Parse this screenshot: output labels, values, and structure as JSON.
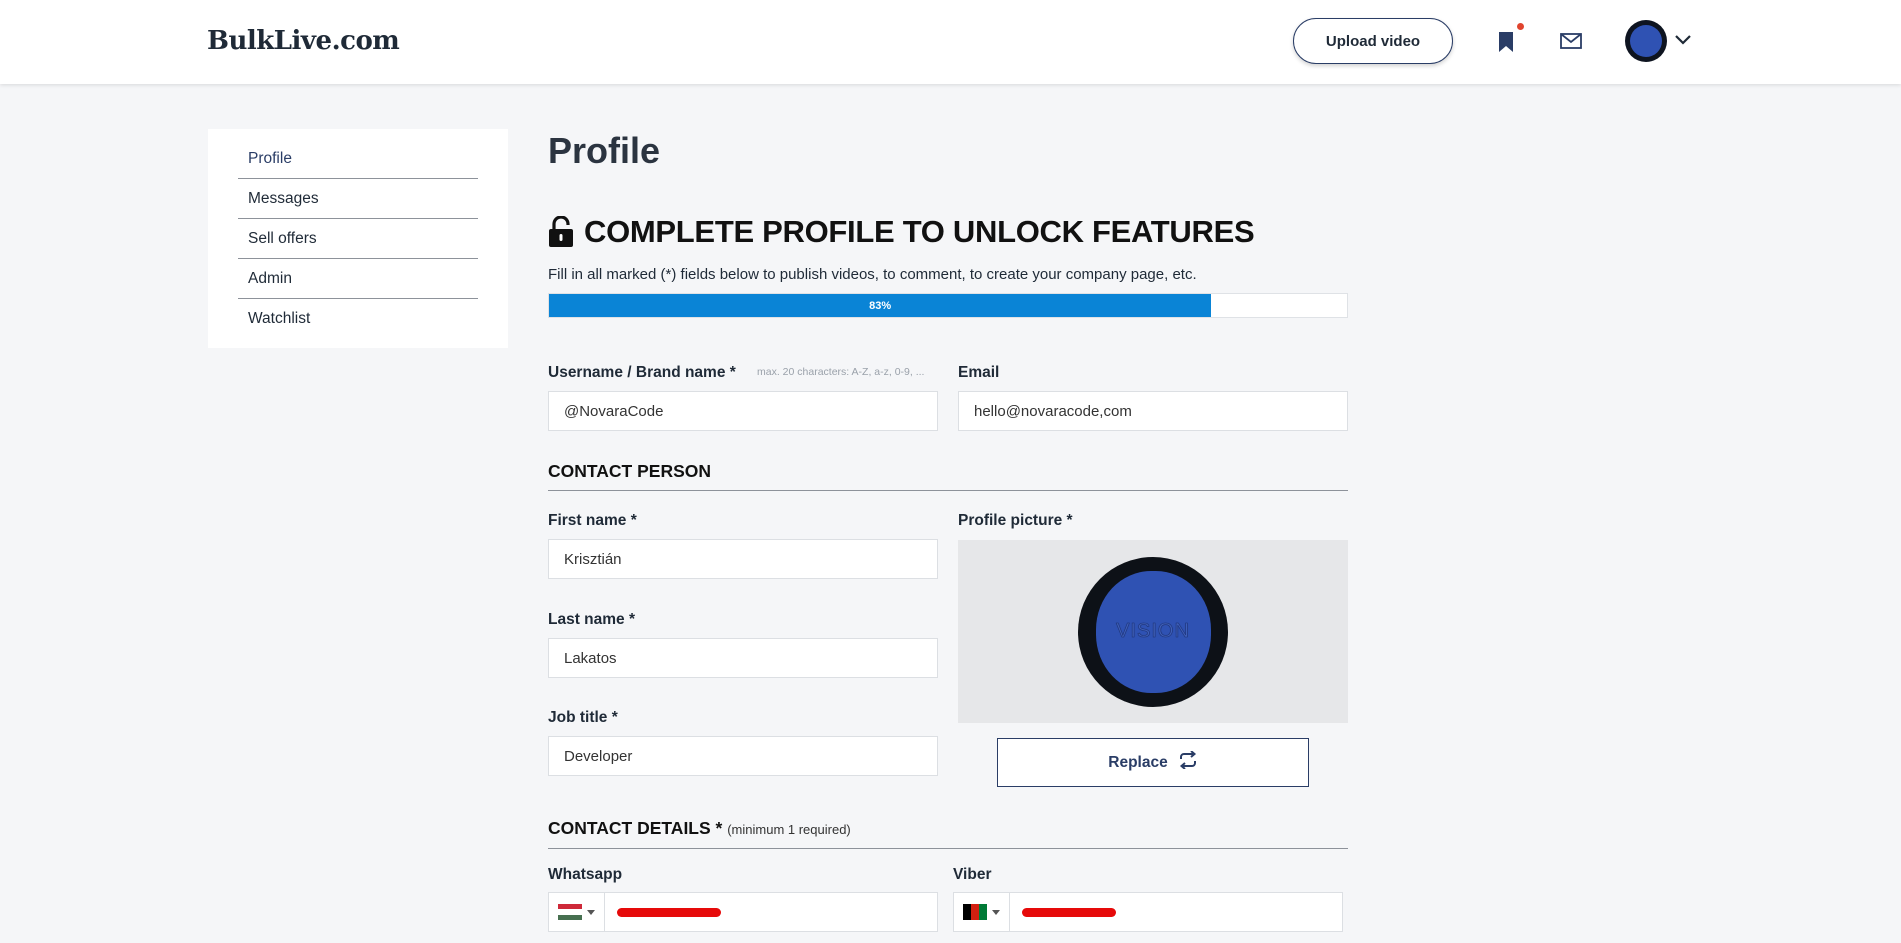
{
  "header": {
    "logo": "BulkLive.com",
    "upload_label": "Upload video",
    "icons": [
      "bookmark-icon",
      "mail-icon",
      "chevron-down-icon"
    ],
    "notification_color": "#e0442e"
  },
  "sidebar": {
    "items": [
      {
        "label": "Profile",
        "active": true
      },
      {
        "label": "Messages"
      },
      {
        "label": "Sell offers"
      },
      {
        "label": "Admin"
      },
      {
        "label": "Watchlist"
      }
    ]
  },
  "main": {
    "title": "Profile",
    "unlock": {
      "heading": "COMPLETE PROFILE TO UNLOCK FEATURES",
      "subtitle": "Fill in all marked (*) fields below to publish videos, to comment, to create your company page, etc.",
      "progress_percent": 83,
      "progress_label": "83%",
      "progress_color": "#0a84d6"
    },
    "username": {
      "label": "Username / Brand name *",
      "hint": "max. 20 characters: A-Z, a-z, 0-9, ...",
      "value": "@NovaraCode"
    },
    "email": {
      "label": "Email",
      "value": "hello@novaracode,com"
    },
    "contact_person": {
      "title": "CONTACT PERSON",
      "first_name": {
        "label": "First name *",
        "value": "Krisztián"
      },
      "last_name": {
        "label": "Last name *",
        "value": "Lakatos"
      },
      "job_title": {
        "label": "Job title *",
        "value": "Developer"
      },
      "profile_picture": {
        "label": "Profile picture *",
        "image_text": "VISION"
      },
      "replace_label": "Replace"
    },
    "contact_details": {
      "title": "CONTACT DETAILS *",
      "note": "(minimum 1 required)",
      "whatsapp": {
        "label": "Whatsapp",
        "flag": "hungary"
      },
      "viber": {
        "label": "Viber",
        "flag": "afghanistan"
      }
    }
  }
}
